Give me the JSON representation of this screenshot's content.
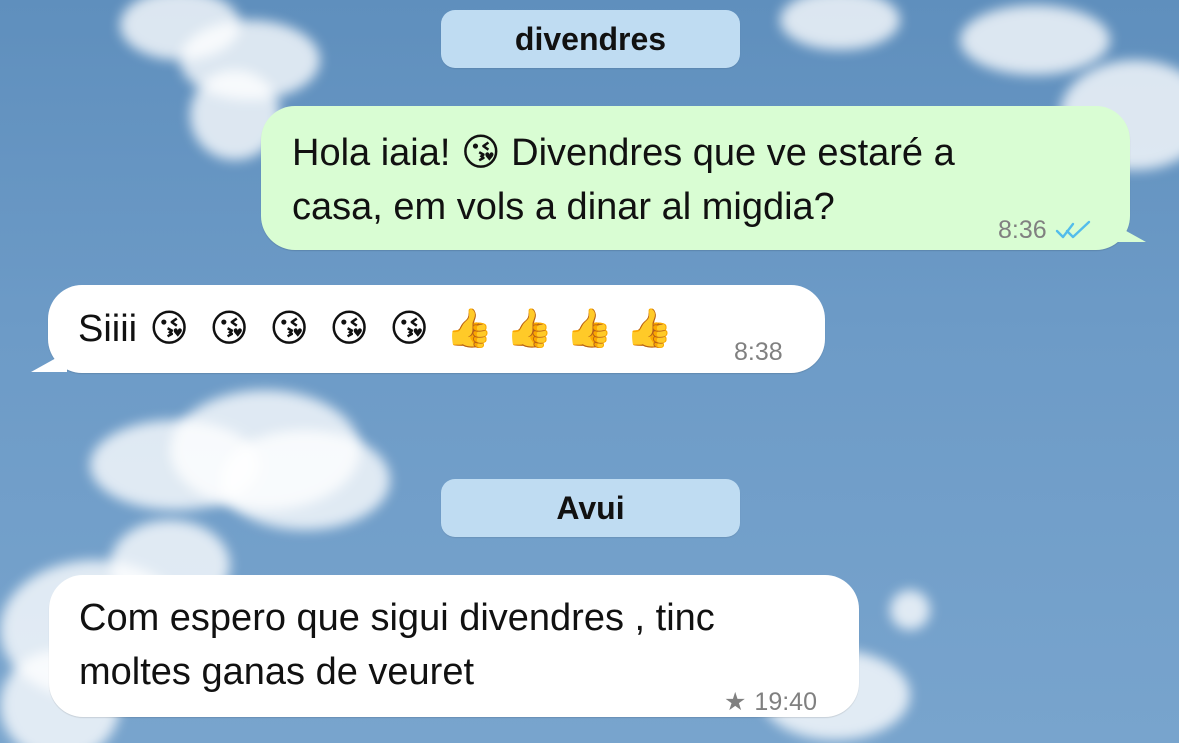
{
  "chat": {
    "date_labels": [
      "divendres",
      "Avui"
    ],
    "messages": [
      {
        "direction": "outgoing",
        "text": "Hola iaia! 😘 Divendres que ve estaré a\ncasa, em vols a dinar al migdia?",
        "time": "8:36",
        "status_icon": "double-check-icon"
      },
      {
        "direction": "incoming",
        "text_prefix": "Siiii",
        "emojis": [
          "😘",
          "😘",
          "😘",
          "😘",
          "😘",
          "👍",
          "👍",
          "👍",
          "👍"
        ],
        "time": "8:38"
      },
      {
        "direction": "incoming",
        "text": "Com espero que sigui divendres , tinc\nmoltes ganas de veuret",
        "time": "19:40",
        "star": "★"
      }
    ]
  },
  "colors": {
    "background": "#6d9bc7",
    "outgoing_bubble": "#d9fdd3",
    "incoming_bubble": "#ffffff",
    "date_pill": "#bfdcf2",
    "tick_blue": "#53bdeb",
    "meta_gray": "#808080"
  }
}
